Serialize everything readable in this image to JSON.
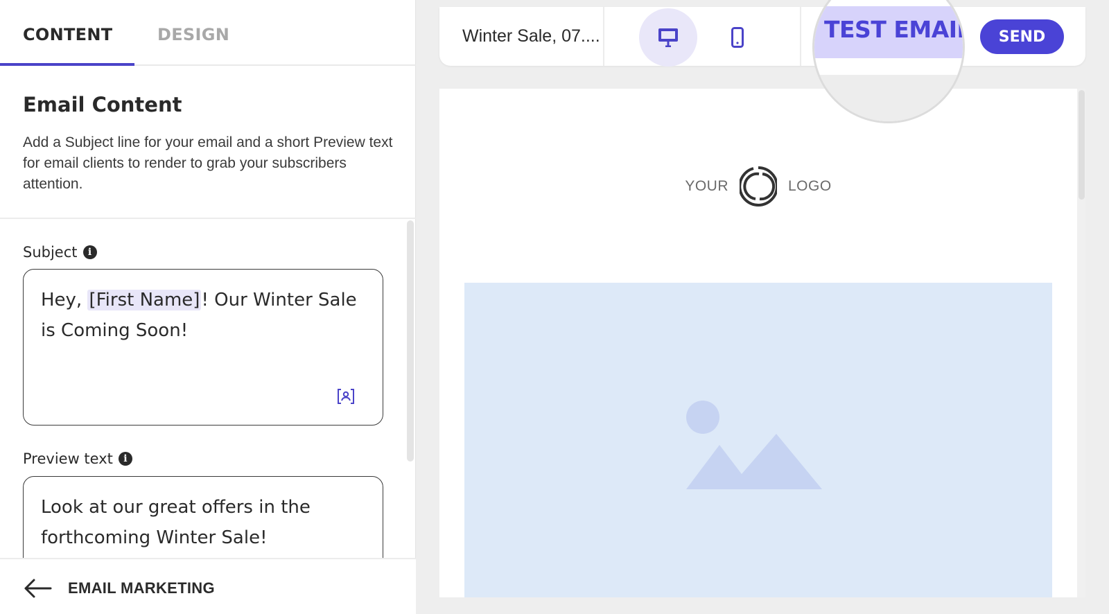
{
  "tabs": {
    "content": "CONTENT",
    "design": "DESIGN"
  },
  "section": {
    "title": "Email Content",
    "description": "Add a Subject line for your email and a short Preview text for email clients to render to grab your subscribers attention."
  },
  "subject": {
    "label": "Subject",
    "text_before": "Hey, ",
    "token": "[First Name]",
    "text_after": "! Our Winter Sale is Coming Soon!"
  },
  "preview_text": {
    "label": "Preview text",
    "value": "Look at our great offers in the forthcoming Winter Sale!"
  },
  "footer": {
    "back_label": "EMAIL MARKETING"
  },
  "toolbar": {
    "campaign_name": "Winter Sale, 07....",
    "test_email_label": "TEST EMAIL",
    "send_label": "SEND"
  },
  "email_preview": {
    "logo_left": "YOUR",
    "logo_right": "LOGO"
  },
  "icons": {
    "info": "info-icon",
    "personalize": "personalize-icon",
    "back": "arrow-left-icon",
    "desktop": "desktop-icon",
    "mobile": "mobile-icon",
    "logo": "circle-logo-icon",
    "image_placeholder": "image-placeholder-icon"
  },
  "colors": {
    "accent": "#4a43d6",
    "token_bg": "#e8e6f8",
    "hero_bg": "#dde9f8"
  }
}
